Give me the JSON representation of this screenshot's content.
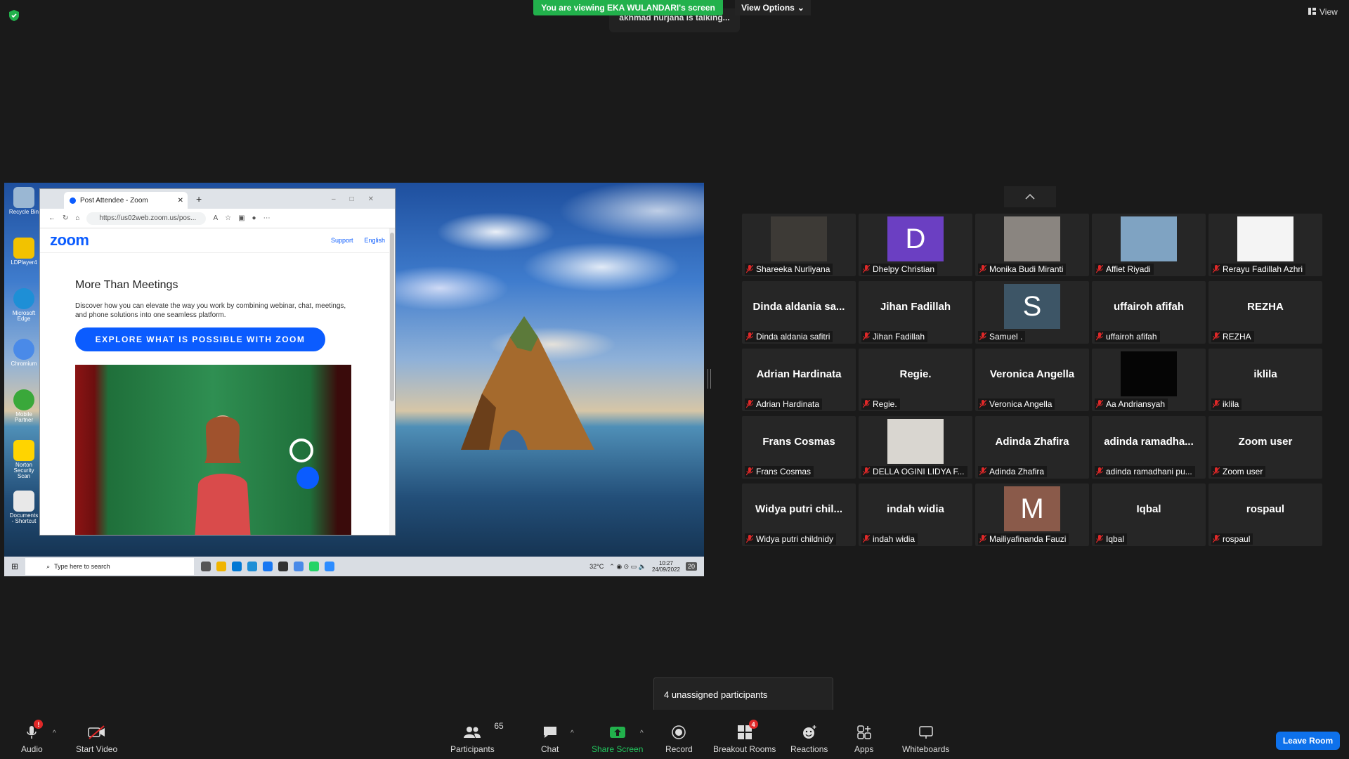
{
  "banner": {
    "viewing_text": "You are viewing EKA WULANDARI's screen",
    "view_options": "View Options",
    "talking": "akhmad nurjana is talking...",
    "view_label": "View"
  },
  "shared_screen": {
    "desktop_icons": [
      "Recycle Bin",
      "LDPlayer4",
      "Microsoft Edge",
      "Chromium",
      "Mobile Partner",
      "Norton Security Scan",
      "Documents - Shortcut"
    ],
    "browser": {
      "tab_title": "Post Attendee - Zoom",
      "url": "https://us02web.zoom.us/pos...",
      "logo": "zoom",
      "nav_support": "Support",
      "nav_language": "English",
      "heading": "More Than Meetings",
      "paragraph": "Discover how you can elevate the way you work by combining webinar, chat, meetings, and phone solutions into one seamless platform.",
      "cta": "EXPLORE WHAT IS POSSIBLE WITH ZOOM"
    },
    "taskbar": {
      "search_placeholder": "Type here to search",
      "weather": "32°C",
      "time": "10:27",
      "date": "24/09/2022",
      "notif_count": "20"
    }
  },
  "participants": [
    {
      "big": "",
      "name": "Shareeka Nurliyana",
      "kind": "photo",
      "color": "#3d3a36"
    },
    {
      "big": "D",
      "name": "Dhelpy Christian",
      "kind": "letter",
      "color": "#6b3fc2"
    },
    {
      "big": "",
      "name": "Monika Budi Miranti",
      "kind": "photo",
      "color": "#8a8580"
    },
    {
      "big": "",
      "name": "Affiet Riyadi",
      "kind": "photo",
      "color": "#7fa3c2"
    },
    {
      "big": "",
      "name": "Rerayu Fadillah Azhri",
      "kind": "photo",
      "color": "#f4f4f4"
    },
    {
      "big": "Dinda aldania sa...",
      "name": "Dinda aldania safitri",
      "kind": "text"
    },
    {
      "big": "Jihan Fadillah",
      "name": "Jihan Fadillah",
      "kind": "text"
    },
    {
      "big": "S",
      "name": "Samuel .",
      "kind": "letter",
      "color": "#3d5566"
    },
    {
      "big": "uffairoh afifah",
      "name": "uffairoh afifah",
      "kind": "text"
    },
    {
      "big": "REZHA",
      "name": "REZHA",
      "kind": "text"
    },
    {
      "big": "Adrian Hardinata",
      "name": "Adrian Hardinata",
      "kind": "text"
    },
    {
      "big": "Regie.",
      "name": "Regie.",
      "kind": "text"
    },
    {
      "big": "Veronica Angella",
      "name": "Veronica Angella",
      "kind": "text"
    },
    {
      "big": "",
      "name": "Aa Andriansyah",
      "kind": "photo",
      "color": "#050505"
    },
    {
      "big": "iklila",
      "name": "iklila",
      "kind": "text"
    },
    {
      "big": "Frans Cosmas",
      "name": "Frans Cosmas",
      "kind": "text"
    },
    {
      "big": "",
      "name": "DELLA OGINI LIDYA F...",
      "kind": "photo",
      "color": "#d9d6d0"
    },
    {
      "big": "Adinda Zhafira",
      "name": "Adinda Zhafira",
      "kind": "text"
    },
    {
      "big": "adinda  ramadha...",
      "name": "adinda ramadhani pu...",
      "kind": "text"
    },
    {
      "big": "Zoom user",
      "name": "Zoom user",
      "kind": "text"
    },
    {
      "big": "Widya  putri  chil...",
      "name": "Widya putri childnidy",
      "kind": "text"
    },
    {
      "big": "indah widia",
      "name": "indah widia",
      "kind": "text"
    },
    {
      "big": "M",
      "name": "Mailiyafinanda Fauzi",
      "kind": "letter",
      "color": "#8a5a4a"
    },
    {
      "big": "Iqbal",
      "name": "Iqbal",
      "kind": "text"
    },
    {
      "big": "rospaul",
      "name": "rospaul",
      "kind": "text"
    }
  ],
  "tooltip": "4 unassigned participants",
  "toolbar": {
    "audio": "Audio",
    "audio_badge": "!",
    "start_video": "Start Video",
    "participants": "Participants",
    "participants_count": "65",
    "chat": "Chat",
    "share_screen": "Share Screen",
    "record": "Record",
    "breakout_rooms": "Breakout Rooms",
    "breakout_badge": "4",
    "reactions": "Reactions",
    "apps": "Apps",
    "whiteboards": "Whiteboards",
    "leave": "Leave Room"
  },
  "colors": {
    "accent": "#0e71eb",
    "share_green": "#22b14c",
    "banner_green": "#22b14c",
    "muted_red": "#e02828"
  }
}
